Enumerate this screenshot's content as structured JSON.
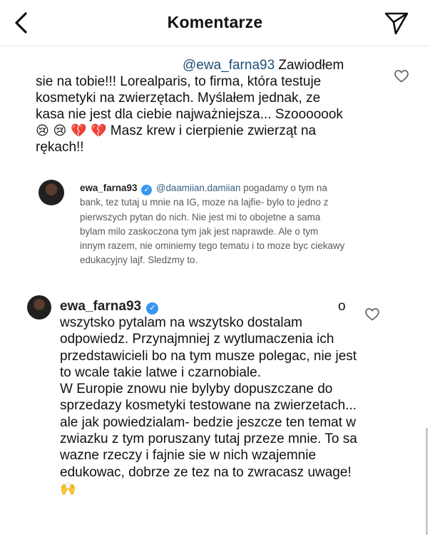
{
  "header": {
    "title": "Komentarze",
    "back_icon": "chevron-left-icon",
    "share_icon": "send-icon"
  },
  "comment1": {
    "mention": "@ewa_farna93",
    "text_a": " Zawiodłem sie na tobie!!! Lorealparis, to firma, która testuje kosmetyki na zwierzętach. Myślałem jednak, ze kasa nie jest dla ciebie najważniejsza... Szooooook ",
    "emojis": "😢 😢 💔 💔",
    "text_b": " Masz krew i cierpienie zwierząt na rękach!!",
    "like_icon": "heart-icon"
  },
  "reply": {
    "username": "ewa_farna93",
    "verified_icon": "verified-badge-icon",
    "mention": "@daamiian.damiian",
    "text": " pogadamy o tym na bank, tez tutaj u mnie na IG, moze na lajfie- bylo to jedno z pierwszych pytan do nich. Nie jest mi to obojetne a sama bylam milo zaskoczona tym jak jest naprawde. Ale o tym innym razem, nie ominiemy tego tematu i to moze byc ciekawy edukacyjny lajf. Sledzmy to."
  },
  "comment3": {
    "username": "ewa_farna93",
    "verified_icon": "verified-badge-icon",
    "head_tail": "o",
    "body": "wszytsko pytalam na wszytsko dostalam odpowiedz. Przynajmniej z wytlumaczenia ich przedstawicieli bo na tym musze polegac, nie jest to wcale takie latwe i czarnobiale.\nW Europie znowu nie bylyby dopuszczane do sprzedazy kosmetyki testowane na zwierzetach... ale jak powiedzialam- bedzie jeszcze ten temat w zwiazku z tym poruszany tutaj przeze mnie. To sa wazne rzeczy i fajnie sie w nich wzajemnie edukowac, dobrze ze tez na to zwracasz uwage!",
    "end_emoji": "🙌",
    "like_icon": "heart-icon"
  }
}
